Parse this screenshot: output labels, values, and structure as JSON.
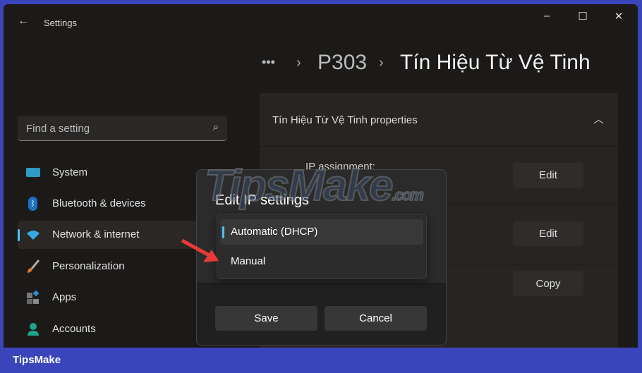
{
  "window": {
    "title": "Settings",
    "controls": {
      "minimize": "–",
      "maximize": "☐",
      "close": "✕"
    }
  },
  "breadcrumb": {
    "more": "•••",
    "parent": "P303",
    "current": "Tín Hiệu Từ Vệ Tinh"
  },
  "search": {
    "placeholder": "Find a setting"
  },
  "sidebar": {
    "items": [
      {
        "label": "System",
        "icon": "monitor-icon"
      },
      {
        "label": "Bluetooth & devices",
        "icon": "bluetooth-icon"
      },
      {
        "label": "Network & internet",
        "icon": "wifi-icon",
        "selected": true
      },
      {
        "label": "Personalization",
        "icon": "brush-icon"
      },
      {
        "label": "Apps",
        "icon": "apps-icon"
      },
      {
        "label": "Accounts",
        "icon": "person-icon"
      }
    ]
  },
  "properties": {
    "header": "Tín Hiệu Từ Vệ Tinh properties",
    "ip_assignment_label": "IP assignment:",
    "edit1": "Edit",
    "edit2": "Edit",
    "copy": "Copy"
  },
  "dialog": {
    "title": "Edit IP settings",
    "options": [
      "Automatic (DHCP)",
      "Manual"
    ],
    "selected": "Automatic (DHCP)",
    "save": "Save",
    "cancel": "Cancel"
  },
  "watermark": "TipsMake.com",
  "footer": {
    "brand": "TipsMake"
  },
  "colors": {
    "accent": "#4cc2ff",
    "frame": "#3a45bb",
    "arrow": "#e8393a"
  }
}
